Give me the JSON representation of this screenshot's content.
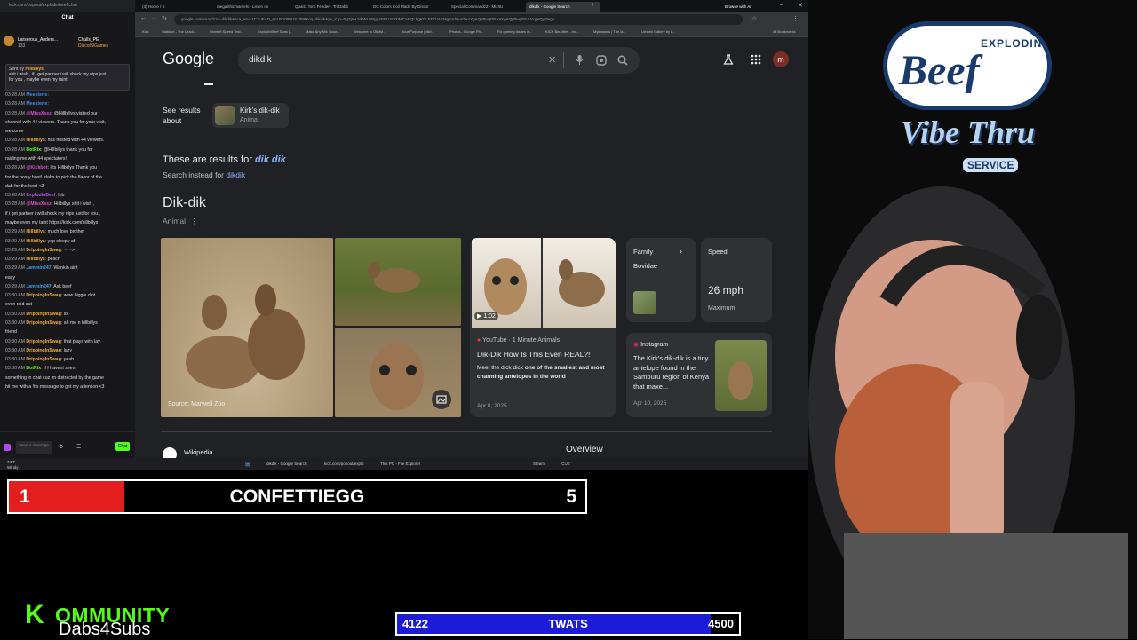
{
  "chat": {
    "url": "kick.com/popout/explodinbeef/chat",
    "title": "Chat",
    "viewer_left": "Larserous_Anders...",
    "viewer_left_count": "133",
    "viewer_right": "Chulls_PE",
    "viewer_right2": "Disco69Games",
    "pinned_header": "Sent by",
    "pinned_user": "Hillbillys",
    "pinned_text1": "shit i wish , if i get partner i will shock my nips just",
    "pinned_text2": "for you , maybe even my taint",
    "messages": [
      {
        "time": "03:28 AM",
        "user": "Meesterie",
        "text": "",
        "color": "#3f8cf0"
      },
      {
        "time": "03:28 AM",
        "user": "Meesterie",
        "text": "",
        "color": "#3f8cf0"
      },
      {
        "time": "03:28 AM",
        "user": "@MissXssz",
        "text": "@Hillbillys visited our",
        "color": "#e04ad3"
      },
      {
        "time": "",
        "user": "",
        "text": "channel with 44 viewers. Thank you for your visit,",
        "color": "#ddd"
      },
      {
        "time": "",
        "user": "",
        "text": "welcome",
        "color": "#ddd"
      },
      {
        "time": "03:28 AM",
        "user": "Hillbillys",
        "text": "has hosted with 44 viewers.",
        "color": "#f2a83a"
      },
      {
        "time": "03:28 AM",
        "user": "BotRix",
        "text": "@Hillbillys thank you for",
        "color": "#53fc18"
      },
      {
        "time": "",
        "user": "",
        "text": "raiding me with 44 spectators!",
        "color": "#ddd"
      },
      {
        "time": "03:28 AM",
        "user": "@Kickbot",
        "text": "Itts Hillbillys Thank you",
        "color": "#e04ad3"
      },
      {
        "time": "",
        "user": "",
        "text": "for the hosty host! !dabs to pick the flavor of the",
        "color": "#ddd"
      },
      {
        "time": "",
        "user": "",
        "text": "dab for the host <3",
        "color": "#ddd"
      },
      {
        "time": "03:28 AM",
        "user": "ExplodinBeef",
        "text": "lhb",
        "color": "#b04af0"
      },
      {
        "time": "03:28 AM",
        "user": "@MissXssz",
        "text": "Hillbillys shit i wish ,",
        "color": "#e04ad3"
      },
      {
        "time": "",
        "user": "",
        "text": "if i get partner i will shock my nips just for you ,",
        "color": "#ddd"
      },
      {
        "time": "",
        "user": "",
        "text": "maybe even my taint https://kick.com/hillbillys",
        "color": "#ddd"
      },
      {
        "time": "03:29 AM",
        "user": "Hillbillys",
        "text": "much love brother",
        "color": "#f2a83a"
      },
      {
        "time": "03:29 AM",
        "user": "Hillbillys",
        "text": "yep sleepy af",
        "color": "#f2a83a"
      },
      {
        "time": "03:29 AM",
        "user": "DrippingInSwag",
        "text": "~~~>",
        "color": "#f2a83a"
      },
      {
        "time": "03:29 AM",
        "user": "Hillbillys",
        "text": "peach",
        "color": "#f2a83a"
      },
      {
        "time": "03:29 AM",
        "user": "Jammin247",
        "text": "Wankin aint",
        "color": "#3fa0f0"
      },
      {
        "time": "",
        "user": "",
        "text": "easy",
        "color": "#ddd"
      },
      {
        "time": "03:29 AM",
        "user": "Jammin247",
        "text": "Ask beef",
        "color": "#3fa0f0"
      },
      {
        "time": "03:30 AM",
        "user": "DrippingInSwag",
        "text": "wow biggie dint",
        "color": "#f2a83a"
      },
      {
        "time": "",
        "user": "",
        "text": "even raid out",
        "color": "#ddd"
      },
      {
        "time": "03:30 AM",
        "user": "DrippingInSwag",
        "text": "lol",
        "color": "#f2a83a"
      },
      {
        "time": "03:30 AM",
        "user": "DrippingInSwag",
        "text": "ah me n hillbillys",
        "color": "#f2a83a"
      },
      {
        "time": "",
        "user": "",
        "text": "friend",
        "color": "#ddd"
      },
      {
        "time": "03:30 AM",
        "user": "DrippingInSwag",
        "text": "that plays with lay",
        "color": "#f2a83a"
      },
      {
        "time": "03:30 AM",
        "user": "DrippingInSwag",
        "text": "lazy",
        "color": "#f2a83a"
      },
      {
        "time": "03:30 AM",
        "user": "DrippingInSwag",
        "text": "yeah",
        "color": "#f2a83a"
      },
      {
        "time": "03:30 AM",
        "user": "BotRix",
        "text": "If I havent seen",
        "color": "#53fc18"
      },
      {
        "time": "",
        "user": "",
        "text": "something in chat cuz im distracted by the game",
        "color": "#ddd"
      },
      {
        "time": "",
        "user": "",
        "text": "hit me with a !tts message to get my attention <3",
        "color": "#ddd"
      }
    ],
    "input_placeholder": "Send a message",
    "chat_button": "Chat"
  },
  "browser": {
    "tabs": [
      "(3) Home / X",
      "megalithicmarvels - Listen on",
      "Quartz Torp Feeder - Tri Dabb",
      "DC Colors Coil Made By Discor",
      "Special Commandz2 - MixItU",
      "dikdik - Google Search"
    ],
    "tab_right": "Browse with AI",
    "url": "google.com/search?q=dikdik&sca_esv=1C1UEAD_enUS1099US1099&oq=dikdik&gs_lcrp=EgZjaHJvbWUyBggAEEUYOTIMCAEQLhgKGLEDGIAEMgkIAhAAGAoYgAQyBwgDEAAYgAQyBwgEEAAYgAQyBwgF",
    "bookmarks": [
      "Kick",
      "Stakkun - The Leadi...",
      "Internet Speed Test...",
      "ExplodinBeef Stats |...",
      "Make Any Mic Soun...",
      "Welcome to Okdivi...",
      "Your Purpose | dict...",
      "Photos - Google Ph...",
      "Fix gaming issues w...",
      "KICK Bounties - em...",
      "Myinstants | The la...",
      "Limited Gallery by k...",
      "All Bookmarks"
    ],
    "logo": "Google",
    "query": "dikdik",
    "see_results": "See results",
    "about": "about",
    "chip_name": "Kirk's dik-dik",
    "chip_type": "Animal",
    "these_prefix": "These are results for",
    "these_term": "dik dik",
    "instead_prefix": "Search instead for",
    "instead_term": "dikdik",
    "kp_title": "Dik-dik",
    "kp_subtitle": "Animal",
    "image_source": "Source: Marwell Zoo",
    "video_duration": "1:02",
    "video_source": "YouTube · 1 Minute Animals",
    "video_title": "Dik-Dik How Is This Even REAL?!",
    "video_desc1": "Meet the dick dick",
    "video_desc_bold": "one of the smallest and most charming antelopes in the world",
    "video_date": "Apr 8, 2025",
    "family_label": "Family",
    "family_value": "Bovidae",
    "speed_label": "Speed",
    "speed_value": "26 mph",
    "speed_sub": "Maximum",
    "insta_source": "Instagram",
    "insta_text": "The Kirk's dik-dik is a tiny antelope found in the Samburu region of Kenya that maxe...",
    "insta_date": "Apr 10, 2025",
    "wiki": "Wikipedia",
    "overview": "Overview"
  },
  "taskbar": {
    "temp": "74°F",
    "weather": "Windy",
    "items": [
      "dikdik - Google Search",
      "kick.com/popout/explo",
      "This PC - File Explorer",
      "Steam",
      "ICUE"
    ]
  },
  "goal_bar_1": {
    "left": "1",
    "label": "CONFETTIEGG",
    "right": "5",
    "progress": 0.2,
    "color": "#e41e1e"
  },
  "goal_bar_2": {
    "left": "4122",
    "label": "TWATS",
    "right": "4500",
    "progress": 0.916,
    "color": "#1c1cd8"
  },
  "brand_logo": {
    "k": "K",
    "word": "OMMUNITY",
    "sub": "Dabs4Subs"
  },
  "stream_logo": {
    "line1": "EXPLODIN",
    "line2": "Beef",
    "line3": "Vibe Thru",
    "line4": "SERVICE"
  }
}
